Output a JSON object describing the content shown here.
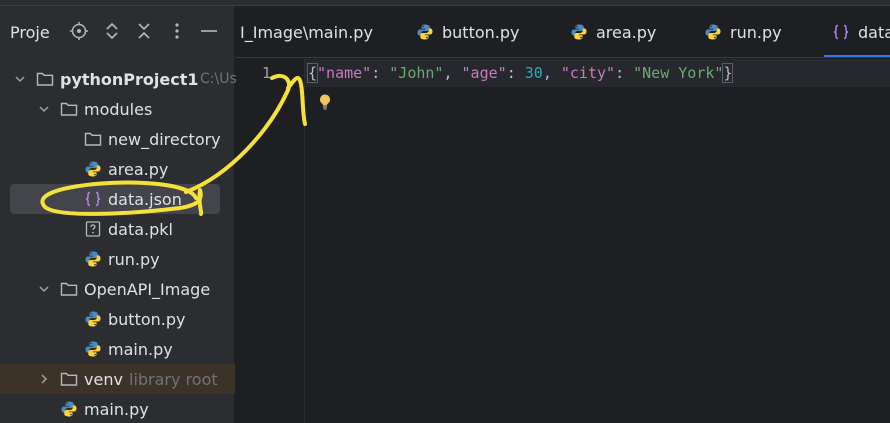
{
  "project_panel": {
    "title": "Proje",
    "icons": [
      "locate-icon",
      "expand-collapse-icon",
      "collapse-all-icon",
      "more-icon",
      "minimize-icon"
    ]
  },
  "tree": [
    {
      "label": "pythonProject1",
      "hint": "C:\\Us",
      "type": "folder",
      "expanded": true,
      "depth": 0
    },
    {
      "label": "modules",
      "type": "folder",
      "expanded": true,
      "depth": 1
    },
    {
      "label": "new_directory",
      "type": "folder",
      "depth": 2
    },
    {
      "label": "area.py",
      "type": "python",
      "depth": 2
    },
    {
      "label": "data.json",
      "type": "json",
      "depth": 2,
      "selected": true
    },
    {
      "label": "data.pkl",
      "type": "unknown",
      "depth": 2
    },
    {
      "label": "run.py",
      "type": "python",
      "depth": 2
    },
    {
      "label": "OpenAPI_Image",
      "type": "folder",
      "expanded": true,
      "depth": 1
    },
    {
      "label": "button.py",
      "type": "python",
      "depth": 2
    },
    {
      "label": "main.py",
      "type": "python",
      "depth": 2
    },
    {
      "label": "venv",
      "hint": "library root",
      "type": "folder",
      "expanded": false,
      "depth": 1
    },
    {
      "label": "main.py",
      "type": "python",
      "depth": 1
    }
  ],
  "tabs": [
    {
      "label": "I_Image\\main.py",
      "type": "none"
    },
    {
      "label": "button.py",
      "type": "python"
    },
    {
      "label": "area.py",
      "type": "python"
    },
    {
      "label": "run.py",
      "type": "python"
    },
    {
      "label": "data",
      "type": "json",
      "active": true
    }
  ],
  "editor": {
    "line_number": "1",
    "code": {
      "open": "{",
      "k1": "\"name\"",
      "s1": "\"John\"",
      "k2": "\"age\"",
      "n2": "30",
      "k3": "\"city\"",
      "s3": "\"New York\"",
      "close": "}",
      "colon": ": ",
      "comma": ", "
    }
  },
  "colors": {
    "accent": "#3574f0",
    "annotation": "#f5e13a",
    "python_blue": "#4b8bbe",
    "python_yellow": "#ffd43b",
    "json_purple": "#b189f5"
  }
}
